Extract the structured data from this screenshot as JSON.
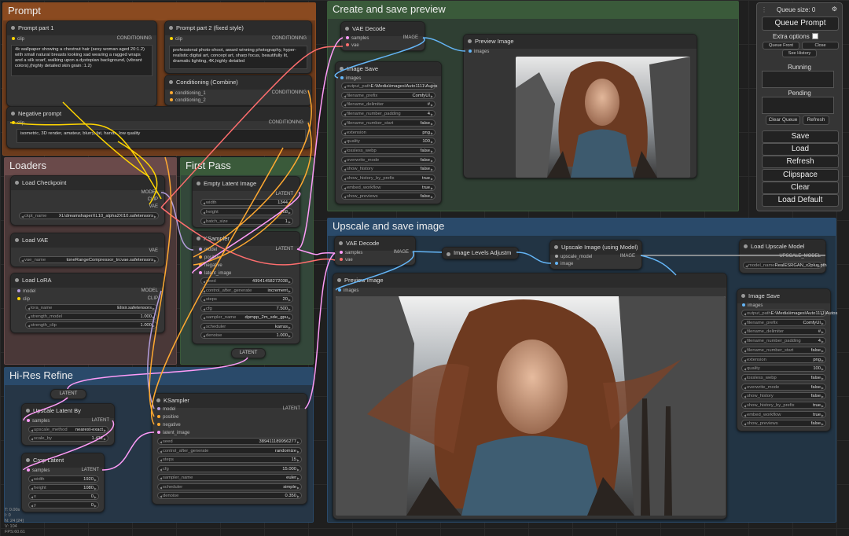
{
  "colors": {
    "prompt_group": "#8a4a20",
    "loaders_group": "#6a4a4a",
    "firstpass_group": "#3a5a3a",
    "hires_group": "#2a4a6a",
    "preview_group": "#3a5a3a",
    "upscale_group": "#2a4a6a"
  },
  "groups": {
    "prompt": "Prompt",
    "loaders": "Loaders",
    "first_pass": "First Pass",
    "hires": "Hi-Res Refine",
    "create_preview": "Create and save preview",
    "upscale": "Upscale and save image"
  },
  "prompt1": {
    "title": "Prompt part 1",
    "input": "clip",
    "output": "CONDITIONING",
    "text": "4k wallpaper showing a chestnut hair (sexy woman aged 20:1.2) with small natural breasts looking  sad wearing a ragged wraps and a silk scarf,  walking upon a  dystopian background, (vibrant colors),(highly detailed skin grain :1.2)"
  },
  "prompt2": {
    "title": "Prompt part 2 (fixed style)",
    "input": "clip",
    "output": "CONDITIONING",
    "text": "professional photo-shoot, award winning photography, hyper-realistic digital art, concept art, sharp focus, beautifully lit, dramatic lighting, 4K,highly detailed"
  },
  "combine": {
    "title": "Conditioning (Combine)",
    "in1": "conditioning_1",
    "in2": "conditioning_2",
    "output": "CONDITIONING"
  },
  "negative": {
    "title": "Negative prompt",
    "input": "clip",
    "output": "CONDITIONING",
    "text": "isometric, 3D render, amateur, blurry, fat, hands, low quality"
  },
  "load_checkpoint": {
    "title": "Load Checkpoint",
    "outs": [
      "MODEL",
      "CLIP",
      "VAE"
    ],
    "label": "ckpt_name",
    "value": "XL\\dreamshaperXL10_alpha2Xl10.safetensors"
  },
  "load_vae": {
    "title": "Load VAE",
    "out": "VAE",
    "label": "vae_name",
    "value": "toneRangeCompressor_trcvae.safetensors"
  },
  "load_lora": {
    "title": "Load LoRA",
    "ins": [
      "model",
      "clip"
    ],
    "outs": [
      "MODEL",
      "CLIP"
    ],
    "widgets": [
      {
        "l": "lora_name",
        "v": "Elixir.safetensors"
      },
      {
        "l": "strength_model",
        "v": "1.000"
      },
      {
        "l": "strength_clip",
        "v": "1.000"
      }
    ]
  },
  "empty_latent": {
    "title": "Empty Latent Image",
    "out": "LATENT",
    "widgets": [
      {
        "l": "width",
        "v": "1344"
      },
      {
        "l": "height",
        "v": "768"
      },
      {
        "l": "batch_size",
        "v": "1"
      }
    ]
  },
  "ksampler1": {
    "title": "KSampler",
    "ins": [
      "model",
      "positive",
      "negative",
      "latent_image"
    ],
    "out": "LATENT",
    "widgets": [
      {
        "l": "seed",
        "v": "49941458272038"
      },
      {
        "l": "control_after_generate",
        "v": "increment"
      },
      {
        "l": "steps",
        "v": "20"
      },
      {
        "l": "cfg",
        "v": "7.500"
      },
      {
        "l": "sampler_name",
        "v": "dpmpp_2m_sde_gpu"
      },
      {
        "l": "scheduler",
        "v": "karras"
      },
      {
        "l": "denoise",
        "v": "1.000"
      }
    ]
  },
  "reroute_latent": "LATENT",
  "reroute_latent2": "LATENT",
  "upscale_latent": {
    "title": "Upscale Latent By",
    "in": "samples",
    "out": "LATENT",
    "widgets": [
      {
        "l": "upscale_method",
        "v": "nearest-exact"
      },
      {
        "l": "scale_by",
        "v": "1.432"
      }
    ]
  },
  "crop_latent": {
    "title": "Crop Latent",
    "in": "samples",
    "out": "LATENT",
    "widgets": [
      {
        "l": "width",
        "v": "1920"
      },
      {
        "l": "height",
        "v": "1080"
      },
      {
        "l": "x",
        "v": "0"
      },
      {
        "l": "y",
        "v": "0"
      }
    ]
  },
  "ksampler2": {
    "title": "KSampler",
    "ins": [
      "model",
      "positive",
      "negative",
      "latent_image"
    ],
    "out": "LATENT",
    "widgets": [
      {
        "l": "seed",
        "v": "389411189956277"
      },
      {
        "l": "control_after_generate",
        "v": "randomize"
      },
      {
        "l": "steps",
        "v": "15"
      },
      {
        "l": "cfg",
        "v": "15.000"
      },
      {
        "l": "sampler_name",
        "v": "euler"
      },
      {
        "l": "scheduler",
        "v": "simple"
      },
      {
        "l": "denoise",
        "v": "0.350"
      }
    ]
  },
  "vae_decode1": {
    "title": "VAE Decode",
    "ins": [
      "samples",
      "vae"
    ],
    "out": "IMAGE"
  },
  "image_save1": {
    "title": "Image Save",
    "in": "images",
    "widgets": [
      {
        "l": "output_path",
        "v": "E:\\Media\\images\\Auto1111\\Autos"
      },
      {
        "l": "filename_prefix",
        "v": "ComfyUI"
      },
      {
        "l": "filename_delimiter",
        "v": "#"
      },
      {
        "l": "filename_number_padding",
        "v": "4"
      },
      {
        "l": "filename_number_start",
        "v": "false"
      },
      {
        "l": "extension",
        "v": "png"
      },
      {
        "l": "quality",
        "v": "100"
      },
      {
        "l": "lossless_webp",
        "v": "false"
      },
      {
        "l": "overwrite_mode",
        "v": "false"
      },
      {
        "l": "show_history",
        "v": "false"
      },
      {
        "l": "show_history_by_prefix",
        "v": "true"
      },
      {
        "l": "embed_workflow",
        "v": "true"
      },
      {
        "l": "show_previews",
        "v": "false"
      }
    ]
  },
  "preview1": {
    "title": "Preview Image",
    "in": "images"
  },
  "vae_decode2": {
    "title": "VAE Decode",
    "ins": [
      "samples",
      "vae"
    ],
    "out": "IMAGE"
  },
  "levels": {
    "title": "Image Levels Adjustm"
  },
  "upscale_model_node": {
    "title": "Upscale Image (using Model)",
    "ins": [
      "upscale_model",
      "image"
    ],
    "out": "IMAGE"
  },
  "load_upscale": {
    "title": "Load Upscale Model",
    "out": "UPSCALE_MODEL",
    "label": "model_name",
    "value": "RealESRGAN_x2plus.pth"
  },
  "preview2": {
    "title": "Preview Image",
    "in": "images"
  },
  "image_save2": {
    "title": "Image Save",
    "in": "images",
    "widgets": [
      {
        "l": "output_path",
        "v": "E:\\Media\\images\\Auto1111\\Autos"
      },
      {
        "l": "filename_prefix",
        "v": "ComfyUI"
      },
      {
        "l": "filename_delimiter",
        "v": "#"
      },
      {
        "l": "filename_number_padding",
        "v": "4"
      },
      {
        "l": "filename_number_start",
        "v": "false"
      },
      {
        "l": "extension",
        "v": "png"
      },
      {
        "l": "quality",
        "v": "100"
      },
      {
        "l": "lossless_webp",
        "v": "false"
      },
      {
        "l": "overwrite_mode",
        "v": "false"
      },
      {
        "l": "show_history",
        "v": "false"
      },
      {
        "l": "show_history_by_prefix",
        "v": "true"
      },
      {
        "l": "embed_workflow",
        "v": "true"
      },
      {
        "l": "show_previews",
        "v": "false"
      }
    ]
  },
  "menu": {
    "queue_size": "Queue size: 0",
    "queue_prompt": "Queue Prompt",
    "extra_options": "Extra options",
    "queue_front": "Queue Front",
    "close": "Close",
    "see_history": "See History",
    "running": "Running",
    "pending": "Pending",
    "clear_queue": "Clear Queue",
    "refresh_small": "Refresh",
    "buttons": [
      "Save",
      "Load",
      "Refresh",
      "Clipspace",
      "Clear",
      "Load Default"
    ]
  },
  "hud": [
    "T: 0.00s",
    "I: 0",
    "N: 24 [24]",
    "V: 104",
    "FPS:60.61"
  ]
}
